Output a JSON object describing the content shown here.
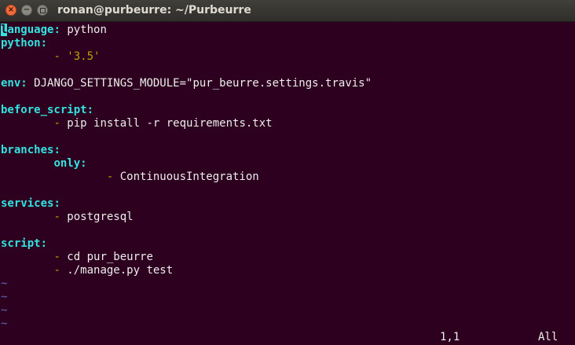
{
  "window": {
    "title": "ronan@purbeurre: ~/Purbeurre"
  },
  "buttons": {
    "close_glyph": "×",
    "min_glyph": "−"
  },
  "editor": {
    "lines": [
      {
        "key": "language",
        "colon": ":",
        "rest": " python"
      },
      {
        "key": "python",
        "colon": ":",
        "rest": ""
      },
      {
        "indent": "        ",
        "dash": "- ",
        "value": "'3.5'"
      },
      {
        "blank": true
      },
      {
        "key": "env",
        "colon": ":",
        "rest": " DJANGO_SETTINGS_MODULE=\"pur_beurre.settings.travis\""
      },
      {
        "blank": true
      },
      {
        "key": "before_script",
        "colon": ":",
        "rest": ""
      },
      {
        "indent": "        ",
        "dash": "- ",
        "value": "pip install -r requirements.txt"
      },
      {
        "blank": true
      },
      {
        "key": "branches",
        "colon": ":",
        "rest": ""
      },
      {
        "indent": "        ",
        "key": "only",
        "colon": ":",
        "rest": ""
      },
      {
        "indent": "                ",
        "dash": "- ",
        "value": "ContinuousIntegration"
      },
      {
        "blank": true
      },
      {
        "key": "services",
        "colon": ":",
        "rest": ""
      },
      {
        "indent": "        ",
        "dash": "- ",
        "value": "postgresql"
      },
      {
        "blank": true
      },
      {
        "key": "script",
        "colon": ":",
        "rest": ""
      },
      {
        "indent": "        ",
        "dash": "- ",
        "value": "cd pur_beurre"
      },
      {
        "indent": "        ",
        "dash": "- ",
        "value": "./manage.py test"
      },
      {
        "tilde": "~"
      },
      {
        "tilde": "~"
      },
      {
        "tilde": "~"
      },
      {
        "tilde": "~"
      }
    ],
    "cursor_char": "l",
    "first_key_rest": "anguage"
  },
  "status": {
    "position": "1,1",
    "scroll": "All"
  },
  "colors": {
    "background": "#2c001e",
    "key": "#34e2e2",
    "dash": "#c4a000",
    "text": "#eeeeec",
    "tilde": "#5c6bc0"
  }
}
